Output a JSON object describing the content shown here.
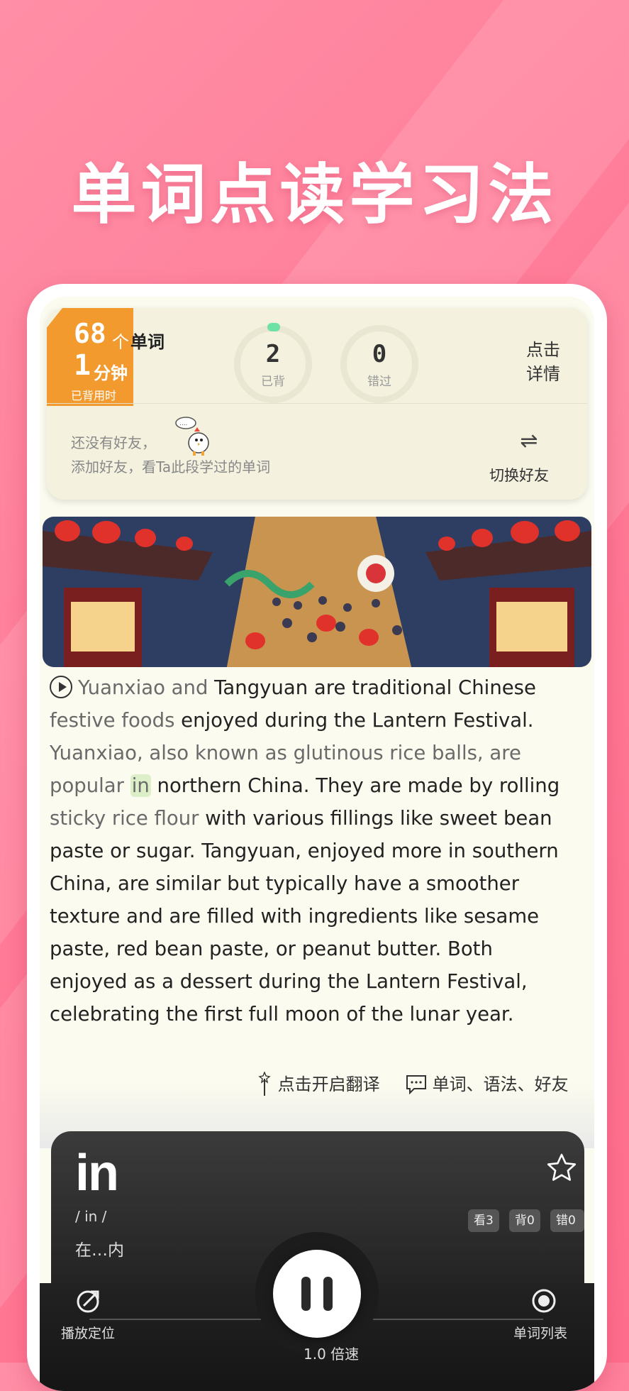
{
  "promo": {
    "title": "单词点读学习法"
  },
  "stats": {
    "word_count": "68",
    "word_unit_ge": "个",
    "word_unit": "单词",
    "minutes": "1",
    "minutes_unit": "分钟",
    "time_label": "已背用时",
    "memorized_count": "2",
    "memorized_label": "已背",
    "missed_count": "0",
    "missed_label": "错过",
    "detail_line1": "点击",
    "detail_line2": "详情"
  },
  "friends": {
    "line1": "还没有好友，",
    "line2": "添加好友，看Ta此段学过的单词",
    "switch_label": "切换好友"
  },
  "passage": {
    "s1": "Yuanxiao and",
    "s2": " Tangyuan are traditional Chinese",
    "s3": "festive foods",
    "s4": " enjoyed during the Lantern Festival.",
    "s5": "Yuanxiao, also known as glutinous rice balls, are",
    "s6": "popular",
    "s7": "in",
    "s8": " northern China. They are made by rolling",
    "s9": "sticky rice flour",
    "s10": " with various fillings like sweet bean",
    "s11": "paste or sugar. Tangyuan, enjoyed more in southern",
    "s12": "China, are similar but typically have a smoother",
    "s13": "texture and are filled with ingredients like sesame",
    "s14": "paste, red bean paste, or peanut butter. Both",
    "s15": "enjoyed as a dessert during the Lantern Festival,",
    "s16": "celebrating the first full moon of the lunar year."
  },
  "actions": {
    "translate": "点击开启翻译",
    "notes": "单词、语法、好友"
  },
  "player": {
    "word": "in",
    "phonetic": "/ in /",
    "meaning": "在…内",
    "look_count": "看3",
    "recite_count": "背0",
    "wrong_count": "错0",
    "locate_label": "播放定位",
    "speed_label": "1.0 倍速",
    "list_label": "单词列表"
  },
  "colors": {
    "accent_orange": "#f29a2e",
    "highlight": "#dcefc9",
    "ring_dot": "#6ee1a5"
  }
}
